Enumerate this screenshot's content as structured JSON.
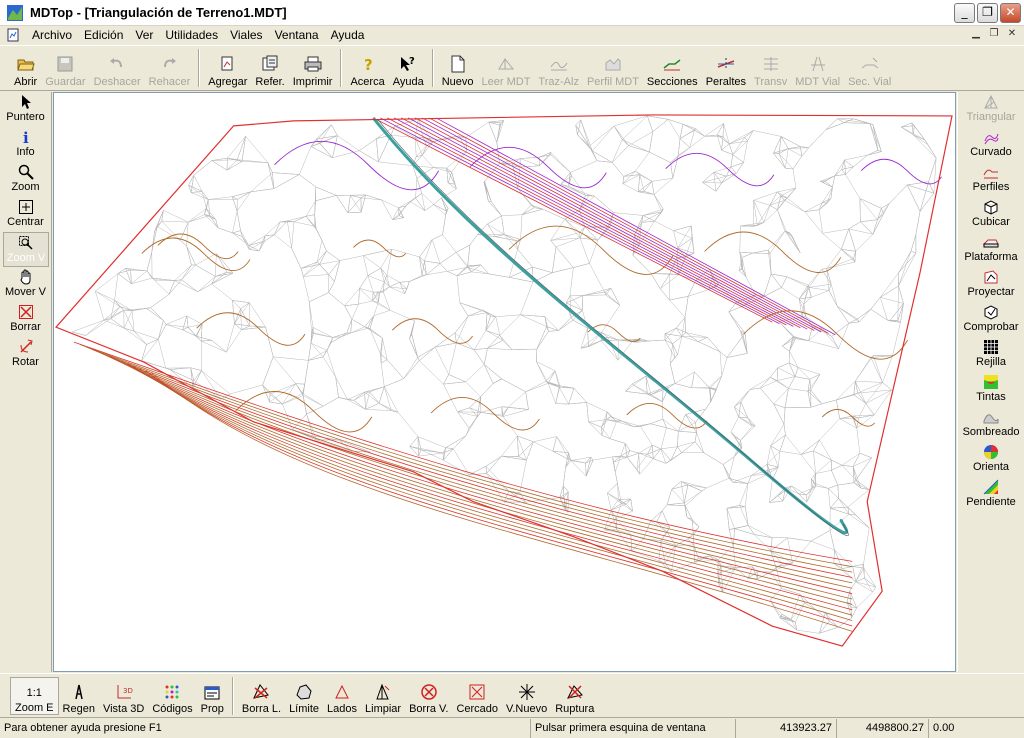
{
  "window": {
    "title": "MDTop - [Triangulación de Terreno1.MDT]",
    "minimize": "_",
    "maximize": "❐",
    "close": "✕"
  },
  "menu": [
    "Archivo",
    "Edición",
    "Ver",
    "Utilidades",
    "Viales",
    "Ventana",
    "Ayuda"
  ],
  "toolbar": [
    {
      "label": "Abrir",
      "icon": "open-folder-icon",
      "enabled": true
    },
    {
      "label": "Guardar",
      "icon": "save-disk-icon",
      "enabled": false
    },
    {
      "label": "Deshacer",
      "icon": "undo-icon",
      "enabled": false
    },
    {
      "label": "Rehacer",
      "icon": "redo-icon",
      "enabled": false
    },
    {
      "label": "Agregar",
      "icon": "add-file-icon",
      "enabled": true
    },
    {
      "label": "Refer.",
      "icon": "reference-icon",
      "enabled": true
    },
    {
      "label": "Imprimir",
      "icon": "printer-icon",
      "enabled": true
    },
    {
      "label": "Acerca",
      "icon": "about-question-icon",
      "enabled": true
    },
    {
      "label": "Ayuda",
      "icon": "help-pointer-icon",
      "enabled": true
    },
    {
      "label": "Nuevo",
      "icon": "new-document-icon",
      "enabled": true
    },
    {
      "label": "Leer MDT",
      "icon": "read-mdt-icon",
      "enabled": false
    },
    {
      "label": "Traz-Alz",
      "icon": "trace-elevation-icon",
      "enabled": false
    },
    {
      "label": "Perfil MDT",
      "icon": "profile-mdt-icon",
      "enabled": false
    },
    {
      "label": "Secciones",
      "icon": "sections-icon",
      "enabled": true
    },
    {
      "label": "Peraltes",
      "icon": "superelevation-icon",
      "enabled": true
    },
    {
      "label": "Transv",
      "icon": "transverse-icon",
      "enabled": false
    },
    {
      "label": "MDT Vial",
      "icon": "mdt-road-icon",
      "enabled": false
    },
    {
      "label": "Sec. Vial",
      "icon": "road-section-icon",
      "enabled": false
    }
  ],
  "left_tools": [
    {
      "label": "Puntero",
      "icon": "pointer-arrow-icon",
      "state": "normal"
    },
    {
      "label": "Info",
      "icon": "info-icon",
      "state": "normal"
    },
    {
      "label": "Zoom",
      "icon": "magnifier-icon",
      "state": "normal"
    },
    {
      "label": "Centrar",
      "icon": "center-crosshair-icon",
      "state": "normal"
    },
    {
      "label": "Zoom V",
      "icon": "zoom-window-icon",
      "state": "active"
    },
    {
      "label": "Mover V",
      "icon": "hand-pan-icon",
      "state": "normal"
    },
    {
      "label": "Borrar",
      "icon": "erase-cross-icon",
      "state": "normal"
    },
    {
      "label": "Rotar",
      "icon": "rotate-icon",
      "state": "normal"
    }
  ],
  "right_tools": [
    {
      "label": "Triangular",
      "icon": "triangulate-icon",
      "enabled": false
    },
    {
      "label": "Curvado",
      "icon": "contour-icon",
      "enabled": true
    },
    {
      "label": "Perfiles",
      "icon": "profiles-icon",
      "enabled": true
    },
    {
      "label": "Cubicar",
      "icon": "volume-cube-icon",
      "enabled": true
    },
    {
      "label": "Plataforma",
      "icon": "platform-icon",
      "enabled": true
    },
    {
      "label": "Proyectar",
      "icon": "project-icon",
      "enabled": true
    },
    {
      "label": "Comprobar",
      "icon": "check-icon",
      "enabled": true
    },
    {
      "label": "Rejilla",
      "icon": "grid-icon",
      "enabled": true
    },
    {
      "label": "Tintas",
      "icon": "color-tints-icon",
      "enabled": true
    },
    {
      "label": "Sombreado",
      "icon": "shading-icon",
      "enabled": true
    },
    {
      "label": "Orienta",
      "icon": "orientation-wheel-icon",
      "enabled": true
    },
    {
      "label": "Pendiente",
      "icon": "slope-triangle-icon",
      "enabled": true
    }
  ],
  "bottom_tools": [
    {
      "top": "1:1",
      "label": "Zoom E",
      "icon": "zoom-extents-icon",
      "selected": true
    },
    {
      "label": "Regen",
      "icon": "regen-icon"
    },
    {
      "label": "Vista 3D",
      "icon": "view-3d-icon"
    },
    {
      "label": "Códigos",
      "icon": "codes-grid-icon"
    },
    {
      "label": "Prop",
      "icon": "properties-icon"
    },
    {
      "label": "Borra L.",
      "icon": "delete-lines-icon"
    },
    {
      "label": "Límite",
      "icon": "limit-icon"
    },
    {
      "label": "Lados",
      "icon": "sides-icon"
    },
    {
      "label": "Limpiar",
      "icon": "clean-icon"
    },
    {
      "label": "Borra V.",
      "icon": "delete-vertex-icon"
    },
    {
      "label": "Cercado",
      "icon": "fence-icon"
    },
    {
      "label": "V.Nuevo",
      "icon": "new-vertex-icon"
    },
    {
      "label": "Ruptura",
      "icon": "breakline-icon"
    }
  ],
  "status": {
    "help": "Para obtener ayuda presione F1",
    "prompt": "Pulsar primera esquina de ventana",
    "x": "413923.27",
    "y": "4498800.27",
    "z": "0.00"
  },
  "colors": {
    "boundary": "#e03030",
    "mesh": "#b8b8b8",
    "contour_brown": "#b06a2a",
    "contour_purple": "#9a2ad0",
    "channel": "#3aa0a0"
  }
}
